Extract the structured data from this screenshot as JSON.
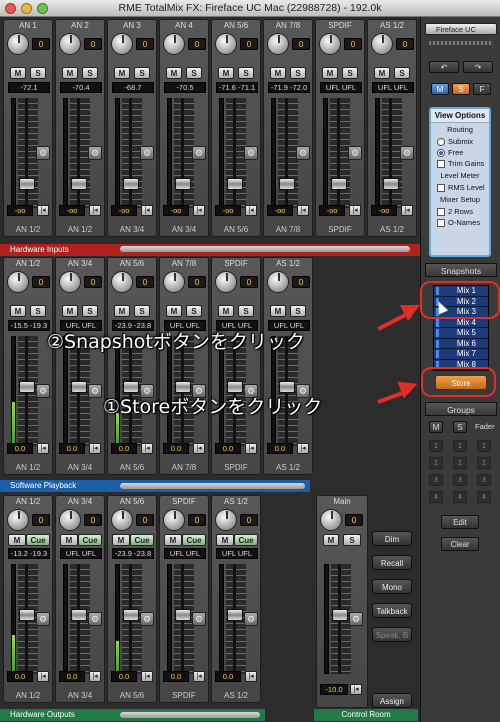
{
  "window": {
    "title": "RME TotalMix FX: Fireface UC Mac (22988728) - 192.0k"
  },
  "rows": {
    "inputs": {
      "label": "Hardware Inputs",
      "channels": [
        {
          "name": "AN 1",
          "gain": "0",
          "pan": "-72.1",
          "level": "-oo",
          "label": "AN 1/2",
          "meter": 0
        },
        {
          "name": "AN 2",
          "gain": "0",
          "pan": "-70.4",
          "level": "-oo",
          "label": "AN 1/2",
          "meter": 0
        },
        {
          "name": "AN 3",
          "gain": "0",
          "pan": "-68.7",
          "level": "-oo",
          "label": "AN 3/4",
          "meter": 0
        },
        {
          "name": "AN 4",
          "gain": "0",
          "pan": "-70.5",
          "level": "-oo",
          "label": "AN 3/4",
          "meter": 0
        },
        {
          "name": "AN 5/6",
          "gain": "0",
          "pan": "-71.6  -71.1",
          "level": "-oo",
          "label": "AN 5/6",
          "meter": 0
        },
        {
          "name": "AN 7/8",
          "gain": "0",
          "pan": "-71.9  -72.0",
          "level": "-oo",
          "label": "AN 7/8",
          "meter": 0
        },
        {
          "name": "SPDIF",
          "gain": "0",
          "pan": "UFL  UFL",
          "level": "-oo",
          "label": "SPDIF",
          "meter": 0
        },
        {
          "name": "AS 1/2",
          "gain": "0",
          "pan": "UFL  UFL",
          "level": "-oo",
          "label": "AS 1/2",
          "meter": 0
        }
      ]
    },
    "playback": {
      "label": "Software Playback",
      "channels": [
        {
          "name": "AN 1/2",
          "gain": "0",
          "pan": "-15.5  -19.3",
          "level": "0.0",
          "label": "AN 1/2",
          "meter": 0.4
        },
        {
          "name": "AN 3/4",
          "gain": "0",
          "pan": "UFL  UFL",
          "level": "0.0",
          "label": "AN 3/4",
          "meter": 0
        },
        {
          "name": "AN 5/6",
          "gain": "0",
          "pan": "-23.9  -23.8",
          "level": "0.0",
          "label": "AN 5/6",
          "meter": 0.3
        },
        {
          "name": "AN 7/8",
          "gain": "0",
          "pan": "UFL  UFL",
          "level": "0.0",
          "label": "AN 7/8",
          "meter": 0
        },
        {
          "name": "SPDIF",
          "gain": "0",
          "pan": "UFL  UFL",
          "level": "0.0",
          "label": "SPDIF",
          "meter": 0
        },
        {
          "name": "AS 1/2",
          "gain": "0",
          "pan": "UFL  UFL",
          "level": "0.0",
          "label": "AS 1/2",
          "meter": 0
        }
      ]
    },
    "outputs": {
      "label": "Hardware Outputs",
      "channels": [
        {
          "name": "AN 1/2",
          "gain": "0",
          "pan": "-13.2  -19.3",
          "level": "0.0",
          "label": "AN 1/2",
          "meter": 0.35
        },
        {
          "name": "AN 3/4",
          "gain": "0",
          "pan": "UFL  UFL",
          "level": "0.0",
          "label": "AN 3/4",
          "meter": 0
        },
        {
          "name": "AN 5/6",
          "gain": "0",
          "pan": "-23.9  -23.8",
          "level": "0.0",
          "label": "AN 5/6",
          "meter": 0.3
        },
        {
          "name": "SPDIF",
          "gain": "0",
          "pan": "UFL  UFL",
          "level": "0.0",
          "label": "SPDIF",
          "meter": 0
        },
        {
          "name": "AS 1/2",
          "gain": "0",
          "pan": "UFL  UFL",
          "level": "0.0",
          "label": "AS 1/2",
          "meter": 0
        }
      ]
    }
  },
  "buttons": {
    "mute": "M",
    "solo": "S",
    "cue": "Cue"
  },
  "control_room": {
    "label": "Control Room",
    "main": {
      "name": "Main",
      "gain": "0",
      "level": "-10.0",
      "label": "Main"
    },
    "buttons": [
      "Dim",
      "Recall",
      "Mono",
      "Talkback",
      "Speak. B",
      "Assign"
    ]
  },
  "sidebar": {
    "device": "Fireface UC",
    "msf": [
      "M",
      "S",
      "F"
    ],
    "view_options": {
      "title": "View Options",
      "routing": "Routing",
      "submix": "Submix",
      "free": "Free",
      "trim_gains": "Trim Gains",
      "level_meter": "Level Meter",
      "rms_level": "RMS Level",
      "mixer_setup": "Mixer Setup",
      "two_rows": "2 Rows",
      "onames": "O-Names"
    },
    "snapshots": {
      "title": "Snapshots",
      "items": [
        "Mix 1",
        "Mix 2",
        "Mix 3",
        "Mix 4",
        "Mix 5",
        "Mix 6",
        "Mix 7",
        "Mix 8"
      ],
      "store": "Store"
    },
    "groups": {
      "title": "Groups",
      "m": "M",
      "s": "S",
      "fader": "Fader",
      "numbers": [
        "1",
        "1",
        "1",
        "2",
        "2",
        "2",
        "3",
        "3",
        "3",
        "4",
        "4",
        "4"
      ],
      "edit": "Edit",
      "clear": "Clear"
    }
  },
  "annotations": {
    "step2": "②Snapshotボタンをクリック",
    "step1": "①Storeボタンをクリック"
  },
  "colors": {
    "inputs": "#b1221f",
    "playback": "#1d5fa6",
    "outputs": "#1f7a45",
    "store": "#e8882c",
    "annotation": "#e03025"
  }
}
